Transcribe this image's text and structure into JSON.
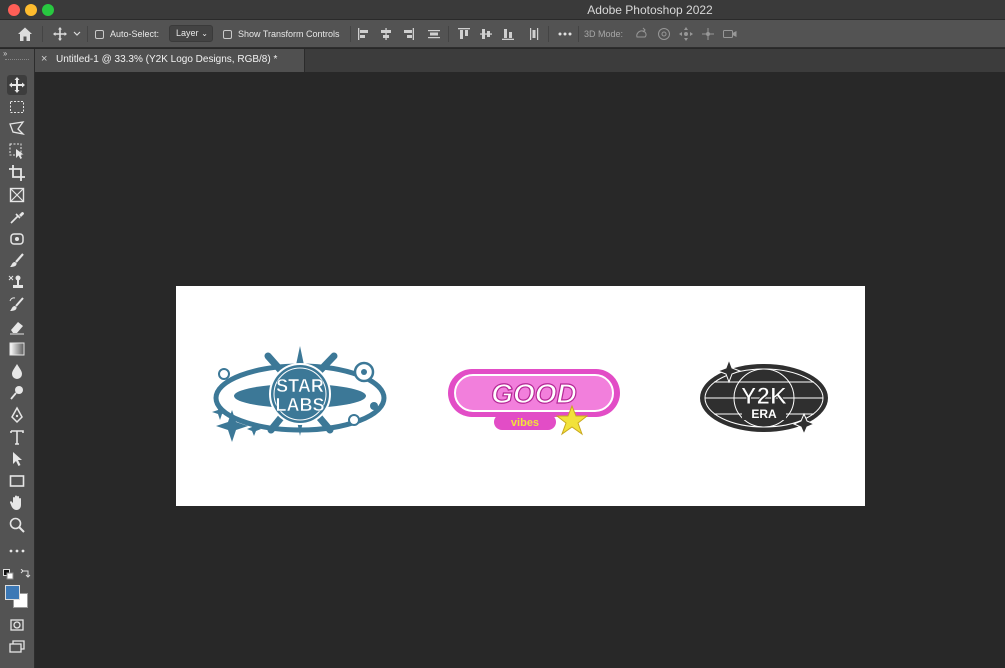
{
  "window": {
    "title": "Adobe Photoshop 2022"
  },
  "options_bar": {
    "auto_select_label": "Auto-Select:",
    "auto_select_checked": false,
    "layer_select_value": "Layer",
    "show_transform_label": "Show Transform Controls",
    "show_transform_checked": false,
    "mode_3d_label": "3D Mode:"
  },
  "document": {
    "tab_title": "Untitled-1 @ 33.3% (Y2K Logo Designs, RGB/8) *"
  },
  "toolbox": {
    "collapse_glyph": "››",
    "tools": [
      "move-tool",
      "marquee-tool",
      "lasso-tool",
      "object-selection-tool",
      "crop-tool",
      "frame-tool",
      "eyedropper-tool",
      "spot-healing-tool",
      "brush-tool",
      "clone-stamp-tool",
      "history-brush-tool",
      "eraser-tool",
      "gradient-tool",
      "blur-tool",
      "dodge-tool",
      "pen-tool",
      "type-tool",
      "path-selection-tool",
      "rectangle-tool",
      "hand-tool",
      "zoom-tool",
      "more-tools"
    ],
    "foreground_color": "#3c78b5",
    "background_color": "#ffffff"
  },
  "canvas": {
    "logos": {
      "starlabs": {
        "line1": "STAR",
        "line2": "LABS",
        "color": "#3c7897"
      },
      "good": {
        "main": "GOOD",
        "sub": "vibes",
        "pink": "#e24dc6",
        "star": "#f2e23a"
      },
      "y2k": {
        "main": "Y2K",
        "sub": "ERA",
        "color": "#2f2f2f"
      }
    }
  },
  "colors": {
    "app_bg": "#282828",
    "panel": "#535353",
    "accent_blue": "#3c78b5"
  }
}
